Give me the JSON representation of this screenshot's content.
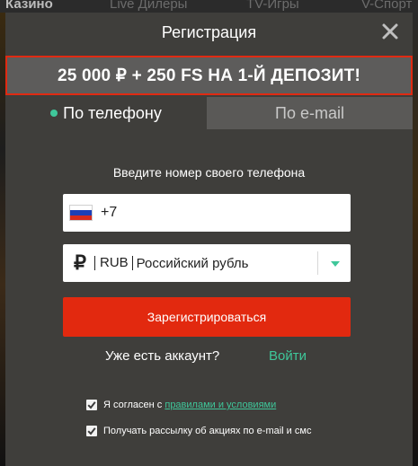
{
  "background_nav": {
    "items": [
      "Казино",
      "Live Дилеры",
      "TV-Игры",
      "V-Спорт"
    ]
  },
  "modal": {
    "title": "Регистрация",
    "close_icon": "close-icon",
    "promo": "25 000 ₽ + 250 FS НА 1-Й ДЕПОЗИТ!",
    "tabs": [
      {
        "label": "По телефону",
        "active": true
      },
      {
        "label": "По e-mail",
        "active": false
      }
    ],
    "prompt": "Введите номер своего телефона",
    "phone": {
      "flag_icon": "russia-flag-icon",
      "code": "+7",
      "value": ""
    },
    "currency": {
      "icon": "ruble-icon",
      "symbol": "₽",
      "code": "RUB",
      "name": "Российский рубль"
    },
    "register_label": "Зарегистрироваться",
    "account_question": "Уже есть аккаунт?",
    "login_label": "Войти",
    "checkboxes": [
      {
        "label_prefix": "Я согласен с ",
        "link": "правилами и условиями",
        "checked": true
      },
      {
        "label": "Получать рассылку об акциях по e-mail и смс",
        "checked": true
      }
    ]
  },
  "colors": {
    "accent_red": "#e2290f",
    "accent_green": "#3fc79a",
    "modal_bg": "#3f3e3b",
    "inactive_tab_bg": "#5a5957"
  }
}
